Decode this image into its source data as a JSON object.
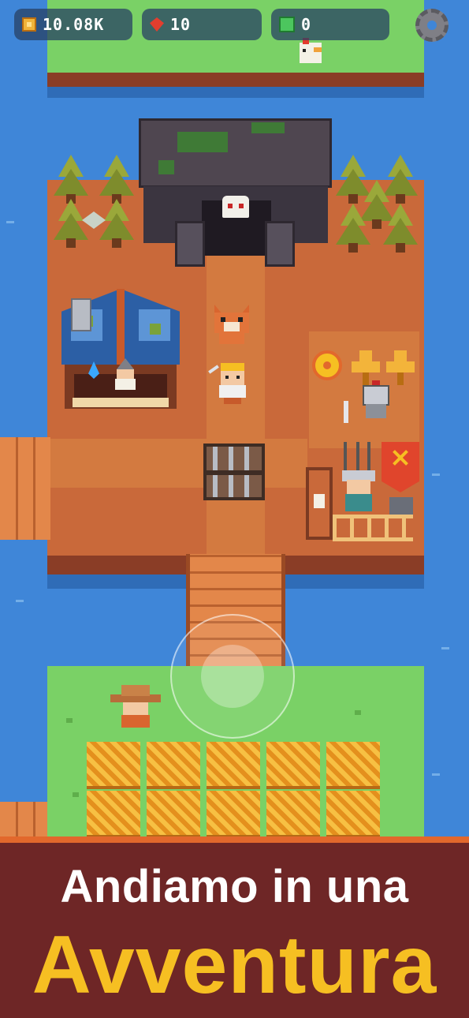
{
  "hud": {
    "coins": "10.08K",
    "gems": "10",
    "green_gems": "0",
    "coin_icon": "coin-icon",
    "gem_icon": "red-gem-icon",
    "green_icon": "green-gem-icon",
    "settings_icon": "gear-icon"
  },
  "caption": {
    "line1": "Andiamo in una",
    "line2": "Avventura"
  },
  "colors": {
    "water": "#3f86d8",
    "grass": "#7ad166",
    "dirt": "#c9693a",
    "caption_bg": "#6e2626",
    "caption_accent": "#f6bf22"
  }
}
